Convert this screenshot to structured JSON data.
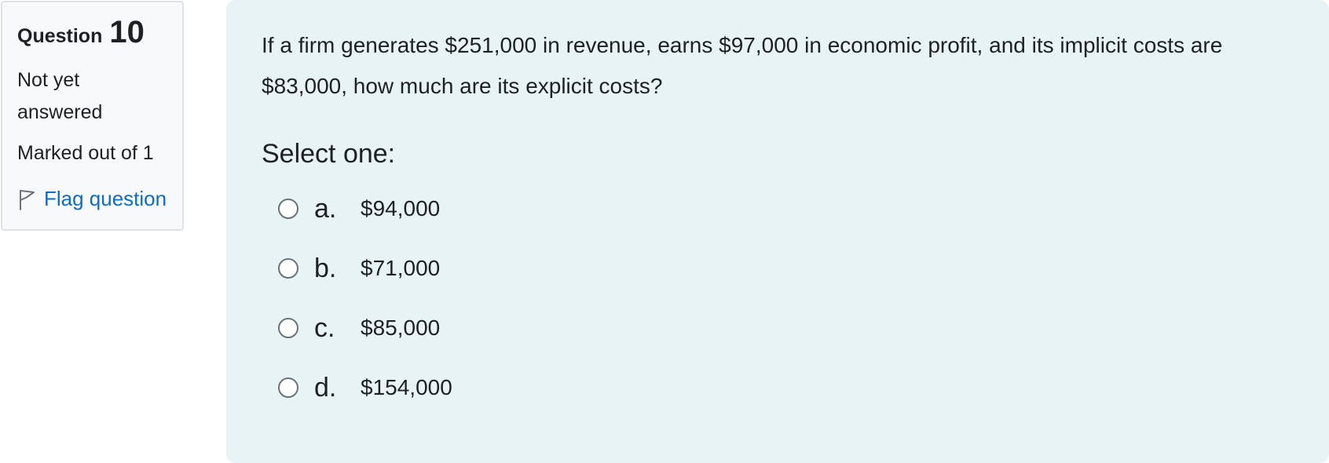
{
  "info": {
    "question_label": "Question",
    "question_number": "10",
    "state": "Not yet answered",
    "grade": "Marked out of 1",
    "flag_label": "Flag question"
  },
  "question": {
    "text": "If a firm generates $251,000 in revenue, earns $97,000 in economic profit, and its implicit costs are $83,000, how much are its explicit costs?",
    "prompt": "Select one:",
    "answers": [
      {
        "letter": "a.",
        "text": "$94,000"
      },
      {
        "letter": "b.",
        "text": "$71,000"
      },
      {
        "letter": "c.",
        "text": "$85,000"
      },
      {
        "letter": "d.",
        "text": "$154,000"
      }
    ]
  },
  "colors": {
    "content_background": "#e7f3f5",
    "link": "#0f6cbf",
    "info_background": "#f8f9fa"
  },
  "icons": {
    "flag": "flag-icon"
  }
}
